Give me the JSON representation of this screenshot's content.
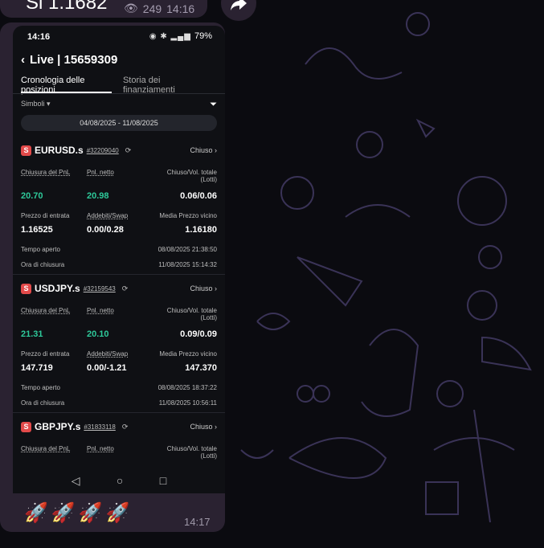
{
  "previous_message": {
    "text": "Sl 1.1682",
    "views": "249",
    "time": "14:16"
  },
  "phone": {
    "status_time": "14:16",
    "battery": "79%",
    "title": "Live | 15659309",
    "tabs": [
      "Cronologia delle posizioni",
      "Storia dei finanziamenti"
    ],
    "symbols_label": "Simboli",
    "date_range": "04/08/2025 - 11/08/2025",
    "trades": [
      {
        "badge": "S",
        "symbol": "EURUSD.s",
        "ticket": "#32209040",
        "status": "Chiuso",
        "closing_pnl_label": "Chiusura del PnL",
        "net_pnl_label": "Pnl. netto",
        "volume_label": "Chiuso/Vol. totale (Lotti)",
        "closing_pnl": "20.70",
        "net_pnl": "20.98",
        "volume": "0.06/0.06",
        "entry_label": "Prezzo di entrata",
        "fees_label": "Addebiti/Swap",
        "close_price_label": "Media Prezzo vicino",
        "entry_price": "1.16525",
        "fees": "0.00/0.28",
        "close_price": "1.16180",
        "open_time_label": "Tempo aperto",
        "open_time": "08/08/2025 21:38:50",
        "close_time_label": "Ora di chiusura",
        "close_time": "11/08/2025 15:14:32"
      },
      {
        "badge": "S",
        "symbol": "USDJPY.s",
        "ticket": "#32159543",
        "status": "Chiuso",
        "closing_pnl_label": "Chiusura del PnL",
        "net_pnl_label": "Pnl. netto",
        "volume_label": "Chiuso/Vol. totale (Lotti)",
        "closing_pnl": "21.31",
        "net_pnl": "20.10",
        "volume": "0.09/0.09",
        "entry_label": "Prezzo di entrata",
        "fees_label": "Addebiti/Swap",
        "close_price_label": "Media Prezzo vicino",
        "entry_price": "147.719",
        "fees": "0.00/-1.21",
        "close_price": "147.370",
        "open_time_label": "Tempo aperto",
        "open_time": "08/08/2025 18:37:22",
        "close_time_label": "Ora di chiusura",
        "close_time": "11/08/2025 10:56:11"
      },
      {
        "badge": "S",
        "symbol": "GBPJPY.s",
        "ticket": "#31833118",
        "status": "Chiuso",
        "closing_pnl_label": "Chiusura del PnL",
        "net_pnl_label": "Pnl. netto",
        "volume_label": "Chiuso/Vol. totale (Lotti)"
      }
    ],
    "nav": [
      "◁",
      "○",
      "□"
    ]
  },
  "caption": {
    "emojis": "🚀🚀🚀🚀",
    "time": "14:17"
  },
  "colors": {
    "positive": "#2ec99a",
    "badge": "#e24a4a",
    "bubble": "#2a2231"
  }
}
